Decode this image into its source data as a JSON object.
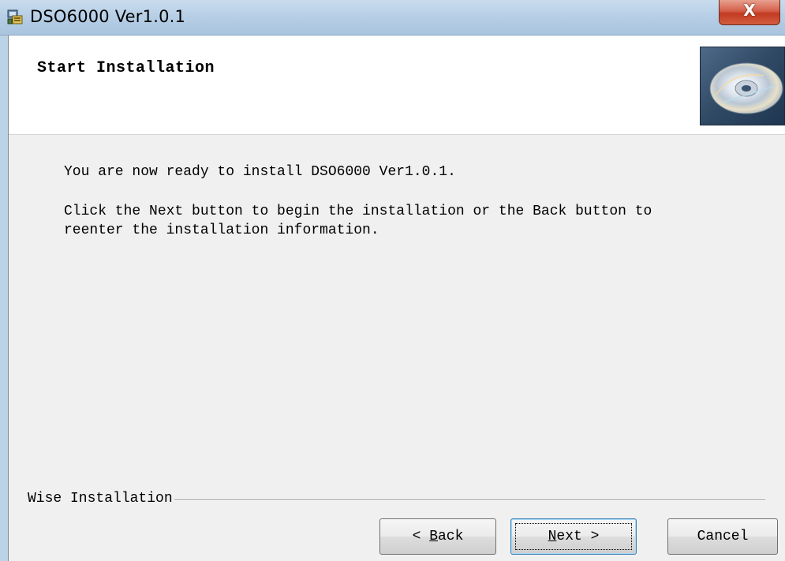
{
  "window": {
    "title": "DSO6000 Ver1.0.1",
    "close_label": "X"
  },
  "header": {
    "title": "Start Installation",
    "image_icon": "cd-disc-icon"
  },
  "body": {
    "line1": "You are now ready to install DSO6000 Ver1.0.1.",
    "line2": "Click the Next button to begin the installation or the Back button to",
    "line3": "reenter the installation information."
  },
  "footer": {
    "group_label": "Wise Installation"
  },
  "buttons": {
    "back": {
      "prefix": "< ",
      "accel": "B",
      "rest": "ack"
    },
    "next": {
      "accel": "N",
      "rest": "ext",
      "suffix": " >"
    },
    "cancel": "Cancel"
  },
  "colors": {
    "titlebar": "#b7cfe6",
    "close_button": "#c23a22",
    "client_bg": "#f0f0f0",
    "header_bg": "#ffffff",
    "cd_box": "#2f4864"
  }
}
